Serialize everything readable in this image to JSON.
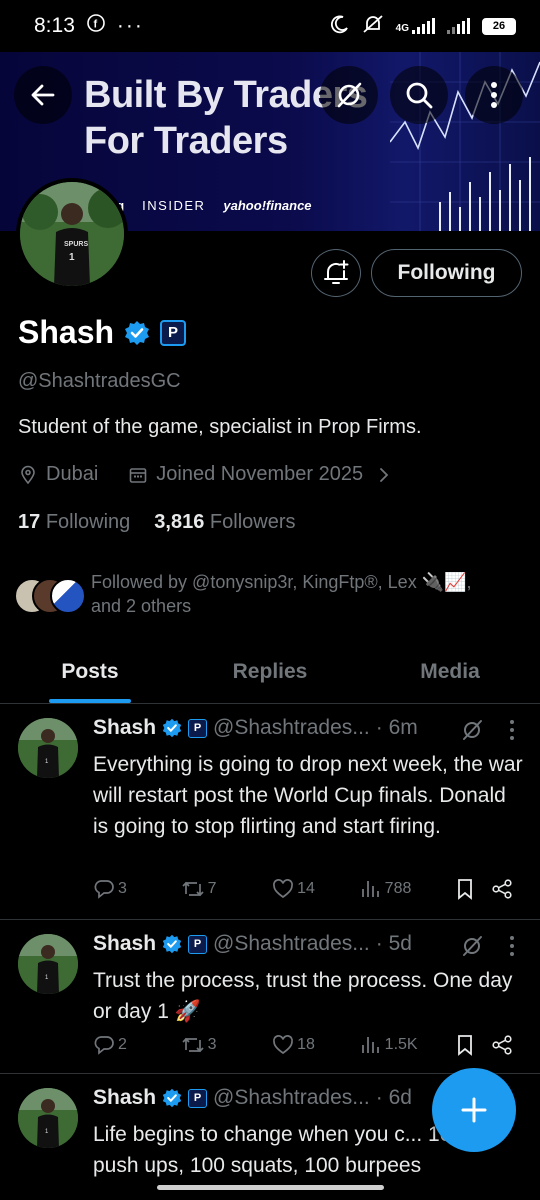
{
  "status_bar": {
    "time": "8:13",
    "network": "4G",
    "battery": "26"
  },
  "banner": {
    "title_line1": "Built By Traders",
    "title_line2": "For Traders",
    "logos": [
      "berg",
      "INSIDER",
      "yahoo!finance"
    ]
  },
  "profile": {
    "name": "Shash",
    "badge_label": "P",
    "handle": "@ShashtradesGC",
    "bio": "Student of the game, specialist in Prop Firms.",
    "location": "Dubai",
    "joined": "Joined November 2025",
    "following_count": "17",
    "following_label": "Following",
    "followers_count": "3,816",
    "followers_label": "Followers",
    "followed_by_line1": "Followed by @tonysnip3r, KingFtp®, Lex 🔌📈,",
    "followed_by_line2": "and 2 others",
    "follow_button": "Following"
  },
  "tabs": [
    {
      "label": "Posts",
      "active": true
    },
    {
      "label": "Replies",
      "active": false
    },
    {
      "label": "Media",
      "active": false
    }
  ],
  "posts": [
    {
      "name": "Shash",
      "handle": "@Shashtrades...",
      "time": "· 6m",
      "text": "Everything is going to drop next week, the war will restart post the World Cup finals. Donald is going to stop flirting and start firing.",
      "replies": "3",
      "reposts": "7",
      "likes": "14",
      "views": "788"
    },
    {
      "name": "Shash",
      "handle": "@Shashtrades...",
      "time": "· 5d",
      "text": "Trust the process, trust the process. One day or day 1 🚀",
      "replies": "2",
      "reposts": "3",
      "likes": "18",
      "views": "1.5K"
    },
    {
      "name": "Shash",
      "handle": "@Shashtrades...",
      "time": "· 6d",
      "text": "Life begins to change when you c... 100 push ups, 100 squats, 100 burpees"
    }
  ],
  "colors": {
    "accent": "#1d9bf0",
    "muted": "#71767b",
    "text": "#e7e9ea",
    "background": "#000000"
  }
}
